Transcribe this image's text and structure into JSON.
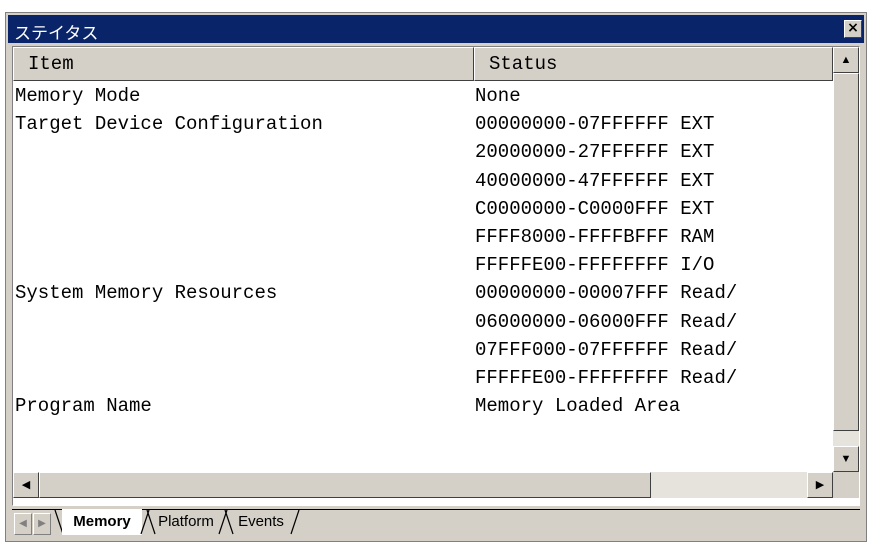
{
  "window": {
    "title": "ステイタス",
    "close_label": "×"
  },
  "columns": {
    "item": "Item",
    "status": "Status"
  },
  "rows": [
    {
      "item": "Memory Mode",
      "status": "None"
    },
    {
      "item": "Target Device Configuration",
      "status": "00000000-07FFFFFF EXT"
    },
    {
      "item": "",
      "status": "20000000-27FFFFFF EXT"
    },
    {
      "item": "",
      "status": "40000000-47FFFFFF EXT"
    },
    {
      "item": "",
      "status": "C0000000-C0000FFF EXT"
    },
    {
      "item": "",
      "status": "FFFF8000-FFFFBFFF RAM"
    },
    {
      "item": "",
      "status": "FFFFFE00-FFFFFFFF I/O"
    },
    {
      "item": "System Memory Resources",
      "status": "00000000-00007FFF Read/"
    },
    {
      "item": "",
      "status": "06000000-06000FFF Read/"
    },
    {
      "item": "",
      "status": "07FFF000-07FFFFFF Read/"
    },
    {
      "item": "",
      "status": "FFFFFE00-FFFFFFFF Read/"
    },
    {
      "item": "Program Name",
      "status": "Memory Loaded Area"
    }
  ],
  "tabs": [
    {
      "label": "Memory",
      "active": true
    },
    {
      "label": "Platform",
      "active": false
    },
    {
      "label": "Events",
      "active": false
    }
  ],
  "icons": {
    "scroll_up": "▲",
    "scroll_down": "▼",
    "scroll_left": "◀",
    "scroll_right": "▶",
    "tab_prev": "◀",
    "tab_next": "▶"
  },
  "colors": {
    "titlebar": "#0a246a",
    "face": "#d4d0c8"
  }
}
